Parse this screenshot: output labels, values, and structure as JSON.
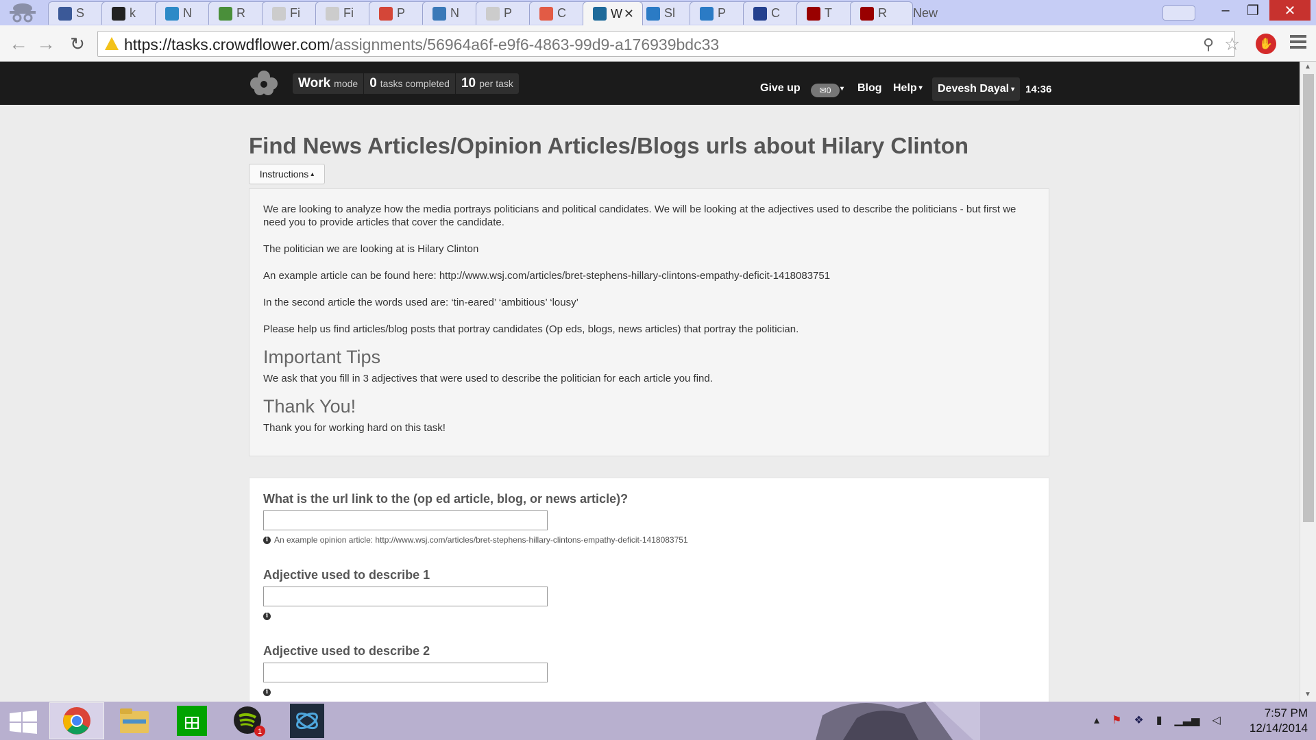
{
  "browser": {
    "tabs": [
      {
        "label": "S",
        "favicon": "facebook-icon",
        "color": "#3b5998"
      },
      {
        "label": "k",
        "favicon": "github-icon",
        "color": "#222222"
      },
      {
        "label": "N",
        "favicon": "pause-app-icon",
        "color": "#2d8ac7"
      },
      {
        "label": "R",
        "favicon": "green-circle-icon",
        "color": "#4a8f3a"
      },
      {
        "label": "Fi",
        "favicon": "document-icon",
        "color": "#cccccc"
      },
      {
        "label": "Fi",
        "favicon": "document-icon",
        "color": "#cccccc"
      },
      {
        "label": "P",
        "favicon": "gmail-icon",
        "color": "#d44638"
      },
      {
        "label": "N",
        "favicon": "p-app-icon",
        "color": "#3a79b8"
      },
      {
        "label": "P",
        "favicon": "document-icon",
        "color": "#cccccc"
      },
      {
        "label": "C",
        "favicon": "crowdflower-icon",
        "color": "#e25b45"
      },
      {
        "label": "W",
        "favicon": "crowdflower-blue-icon",
        "color": "#1d6a9a"
      },
      {
        "label": "Sl",
        "favicon": "sj-icon",
        "color": "#2b7bc5"
      },
      {
        "label": "P",
        "favicon": "sj-icon",
        "color": "#2b7bc5"
      },
      {
        "label": "C",
        "favicon": "shield-icon",
        "color": "#23408e"
      },
      {
        "label": "T",
        "favicon": "penn-shield-icon",
        "color": "#990000"
      },
      {
        "label": "R",
        "favicon": "penn-shield-icon",
        "color": "#990000"
      },
      {
        "label": "New",
        "favicon": "",
        "color": ""
      }
    ],
    "active_tab_index": 10,
    "url_scheme_host": "https://tasks.crowdflower.com",
    "url_path": "/assignments/56964a6f-e9f6-4863-99d9-a176939bdc33"
  },
  "nav": {
    "work_label": "Work",
    "mode_label": "mode",
    "tasks_completed_count": "0",
    "tasks_completed_label": "tasks completed",
    "per_task_count": "10",
    "per_task_label": "per task",
    "give_up": "Give up",
    "mail_count": "0",
    "blog": "Blog",
    "help": "Help",
    "user_name": "Devesh Dayal",
    "timer": "14:36"
  },
  "job": {
    "title": "Find News Articles/Opinion Articles/Blogs urls about Hilary Clinton",
    "instructions_button": "Instructions",
    "paragraphs": [
      "We are looking to analyze how the media portrays politicians and political candidates. We will be looking at the adjectives used to describe the politicians - but first we need you to provide articles that cover the candidate.",
      "The politician we are looking at is Hilary Clinton",
      "An example article can be found here: http://www.wsj.com/articles/bret-stephens-hillary-clintons-empathy-deficit-1418083751",
      "In the second article the words used are: ‘tin-eared’ ‘ambitious’ ‘lousy’",
      "Please help us find articles/blog posts that portray candidates (Op eds, blogs, news articles) that portray the politician."
    ],
    "tips_heading": "Important Tips",
    "tips_text": "We ask that you fill in 3 adjectives that were used to describe the politician for each article you find.",
    "thanks_heading": "Thank You!",
    "thanks_text": "Thank you for working hard on this task!"
  },
  "form": {
    "fields": [
      {
        "label": "What is the url link to the (op ed article, blog, or news article)?",
        "value": "",
        "hint": "An example opinion article: http://www.wsj.com/articles/bret-stephens-hillary-clintons-empathy-deficit-1418083751"
      },
      {
        "label": "Adjective used to describe 1",
        "value": "",
        "hint": ""
      },
      {
        "label": "Adjective used to describe 2",
        "value": "",
        "hint": ""
      }
    ]
  },
  "taskbar": {
    "clock_time": "7:57 PM",
    "clock_date": "12/14/2014",
    "spotify_badge": "1"
  }
}
